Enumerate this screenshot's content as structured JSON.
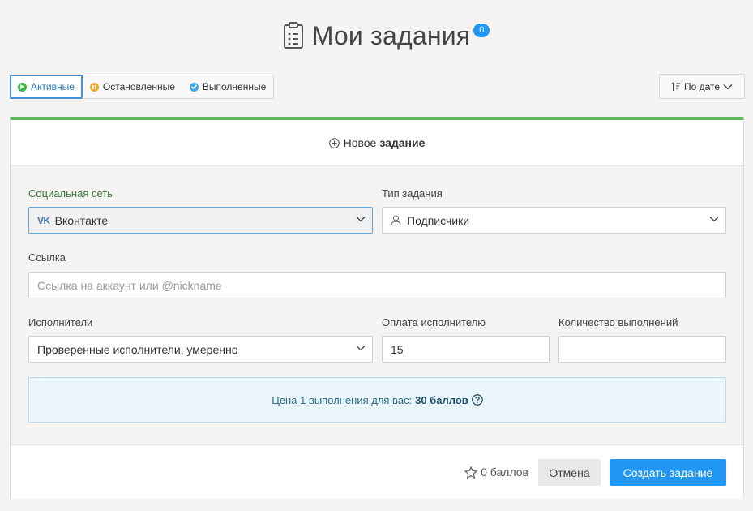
{
  "header": {
    "title": "Мои задания",
    "badge_count": "0",
    "icon": "clipboard-list-icon"
  },
  "filters": [
    {
      "label": "Активные",
      "icon": "play-circle-icon",
      "color": "#3bb54a",
      "active": true
    },
    {
      "label": "Остановленные",
      "icon": "pause-circle-icon",
      "color": "#f5a623",
      "active": false
    },
    {
      "label": "Выполненные",
      "icon": "check-circle-icon",
      "color": "#46a5e8",
      "active": false
    }
  ],
  "sort": {
    "label": "По дате",
    "icon": "sort-icon"
  },
  "card": {
    "accent_color": "#5cb85c",
    "new_task_prefix": "Новое",
    "new_task_bold": "задание",
    "form": {
      "social_label": "Социальная сеть",
      "social_value": "Вконтакте",
      "social_logo": "VK",
      "task_type_label": "Тип задания",
      "task_type_value": "Подписчики",
      "link_label": "Ссылка",
      "link_placeholder": "Ссылка на аккаунт или @nickname",
      "performers_label": "Исполнители",
      "performers_value": "Проверенные исполнители, умеренно",
      "payment_label": "Оплата исполнителю",
      "payment_value": "15",
      "quantity_label": "Количество выполнений",
      "quantity_value": ""
    },
    "price": {
      "text": "Цена 1 выполнения для вас:",
      "value": "30 баллов"
    },
    "footer": {
      "points": "0 баллов",
      "cancel_label": "Отмена",
      "create_label": "Создать задание",
      "create_color": "#2196f3"
    }
  }
}
